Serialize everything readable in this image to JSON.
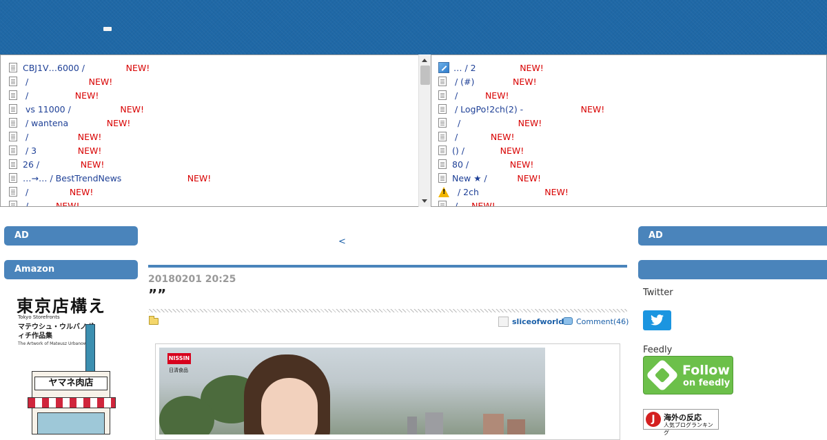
{
  "antenna_left": [
    {
      "title": "CBJ1V…6000 / ",
      "gap": "              ",
      "new": "NEW!"
    },
    {
      "title": " / ",
      "gap": "                     ",
      "new": "NEW!"
    },
    {
      "title": " / ",
      "gap": "                ",
      "new": "NEW!"
    },
    {
      "title": " vs 11000 / ",
      "gap": "                 ",
      "new": "NEW!"
    },
    {
      "title": " / wantena",
      "gap": "              ",
      "new": "NEW!"
    },
    {
      "title": " / ",
      "gap": "                 ",
      "new": "NEW!"
    },
    {
      "title": " / 3",
      "gap": "               ",
      "new": "NEW!"
    },
    {
      "title": "26 / ",
      "gap": "              ",
      "new": "NEW!"
    },
    {
      "title": "…→… / BestTrendNews",
      "gap": "                        ",
      "new": "NEW!"
    },
    {
      "title": " / ",
      "gap": "              ",
      "new": "NEW!"
    },
    {
      "title": " / ",
      "gap": "         ",
      "new": "NEW!"
    }
  ],
  "antenna_right": [
    {
      "icon": "pen",
      "title": "… / 2",
      "gap": "                ",
      "new": "NEW!"
    },
    {
      "icon": "doc",
      "title": " / (#)",
      "gap": "              ",
      "new": "NEW!"
    },
    {
      "icon": "doc",
      "title": " / ",
      "gap": "         ",
      "new": "NEW!"
    },
    {
      "icon": "doc",
      "title": " / LogPo!2ch(2) - ",
      "gap": "                    ",
      "new": "NEW!"
    },
    {
      "icon": "doc",
      "title": "  / ",
      "gap": "                    ",
      "new": "NEW!"
    },
    {
      "icon": "doc",
      "title": " / ",
      "gap": "           ",
      "new": "NEW!"
    },
    {
      "icon": "doc",
      "title": "() / ",
      "gap": "            ",
      "new": "NEW!"
    },
    {
      "icon": "doc",
      "title": "80 / ",
      "gap": "              ",
      "new": "NEW!"
    },
    {
      "icon": "doc",
      "title": "New ★ / ",
      "gap": "          ",
      "new": "NEW!"
    },
    {
      "icon": "warning",
      "title": " / 2ch",
      "gap": "                        ",
      "new": "NEW!"
    },
    {
      "icon": "doc",
      "title": " / ",
      "gap": "    ",
      "new": "NEW!"
    }
  ],
  "sidebar_left": {
    "ad_label": "AD",
    "amazon_label": "Amazon",
    "book": {
      "title": "東京店構え",
      "subtitle": "Tokyo Storefronts",
      "author": "マテウシュ・ウルバノヴィチ作品集",
      "subtitle2": "The Artwork of Mateusz Urbanowicz",
      "shop_sign": "ヤマネ肉店"
    }
  },
  "sidebar_right": {
    "ad_label": "AD",
    "blank_label": "",
    "twitter_label": "Twitter",
    "feedly_label": "Feedly",
    "feedly_follow": "Follow",
    "feedly_on": "on feedly",
    "ranking_line1": "海外の反応",
    "ranking_line2": "人気ブログランキング",
    "ranking_logo": "J"
  },
  "post": {
    "prev_link": "<",
    "date": "20180201 20:25",
    "title": "””",
    "author": "sliceofworld",
    "comments": "Comment(46)",
    "image": {
      "logo": "NISSIN",
      "logo_sub": "日清食品"
    }
  },
  "colors": {
    "header": "#1f68a6",
    "accent": "#4a84bb",
    "link": "#1d3f96",
    "new": "#d80000"
  }
}
